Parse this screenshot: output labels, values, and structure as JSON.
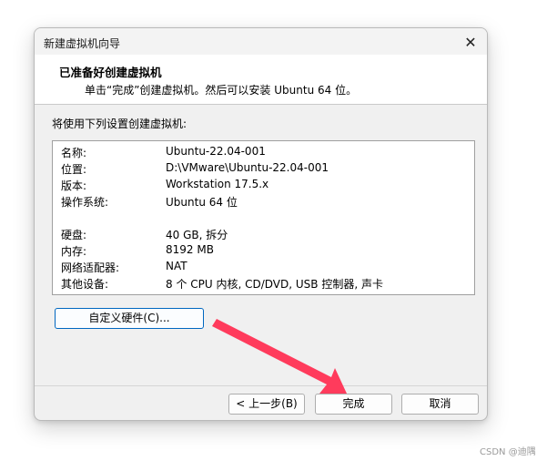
{
  "window": {
    "title": "新建虚拟机向导",
    "close_glyph": "✕"
  },
  "header": {
    "title": "已准备好创建虚拟机",
    "subtitle": "单击“完成”创建虚拟机。然后可以安装 Ubuntu 64 位。"
  },
  "summary_label": "将使用下列设置创建虚拟机:",
  "settings": [
    {
      "key": "名称:",
      "value": "Ubuntu-22.04-001"
    },
    {
      "key": "位置:",
      "value": "D:\\VMware\\Ubuntu-22.04-001"
    },
    {
      "key": "版本:",
      "value": "Workstation 17.5.x"
    },
    {
      "key": "操作系统:",
      "value": "Ubuntu 64 位"
    },
    {
      "key": "硬盘:",
      "value": "40 GB, 拆分"
    },
    {
      "key": "内存:",
      "value": "8192 MB"
    },
    {
      "key": "网络适配器:",
      "value": "NAT"
    },
    {
      "key": "其他设备:",
      "value": "8 个 CPU 内核, CD/DVD, USB 控制器, 声卡"
    }
  ],
  "buttons": {
    "customize": "自定义硬件(C)...",
    "back": "< 上一步(B)",
    "finish": "完成",
    "cancel": "取消"
  },
  "annotation": {
    "arrow_color": "#ff3b5c"
  },
  "watermark": "CSDN @迪隅"
}
